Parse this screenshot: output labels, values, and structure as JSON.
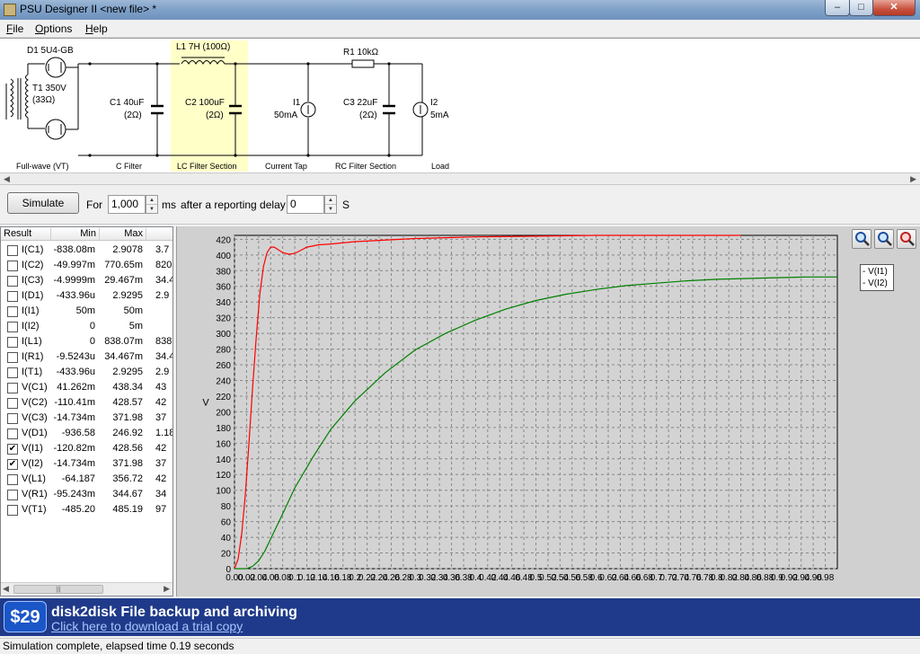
{
  "window": {
    "title": "PSU Designer II  <new file> *",
    "buttons": {
      "minimize": "‒",
      "maximize": "□",
      "close": "✕"
    }
  },
  "menu": [
    "File",
    "Options",
    "Help"
  ],
  "schematic": {
    "labels": {
      "d1": "D1 5U4-GB",
      "t1": "T1 350V",
      "t1_r": "(33Ω)",
      "c1": "C1 40uF",
      "c1_r": "(2Ω)",
      "l1": "L1 7H (100Ω)",
      "c2": "C2 100uF",
      "c2_r": "(2Ω)",
      "i1": "I1",
      "i1_v": "50mA",
      "r1": "R1 10kΩ",
      "c3": "C3 22uF",
      "c3_r": "(2Ω)",
      "i2": "I2",
      "i2_v": "5mA"
    },
    "sections": [
      "Full-wave (VT)",
      "C Filter",
      "LC Filter Section",
      "Current Tap",
      "RC Filter Section",
      "Load"
    ]
  },
  "toolbar": {
    "simulate_label": "Simulate",
    "for_label": "For",
    "duration_value": "1,000",
    "duration_unit": "ms",
    "delay_label": "after a reporting delay of",
    "delay_value": "0",
    "delay_unit": "S"
  },
  "results": {
    "columns": [
      "Result",
      "Min",
      "Max"
    ],
    "rows": [
      {
        "name": "I(C1)",
        "min": "-838.08m",
        "max": "2.9078",
        "extra": "3.7",
        "checked": false
      },
      {
        "name": "I(C2)",
        "min": "-49.997m",
        "max": "770.65m",
        "extra": "820.",
        "checked": false
      },
      {
        "name": "I(C3)",
        "min": "-4.9999m",
        "max": "29.467m",
        "extra": "34.4",
        "checked": false
      },
      {
        "name": "I(D1)",
        "min": "-433.96u",
        "max": "2.9295",
        "extra": "2.9",
        "checked": false
      },
      {
        "name": "I(I1)",
        "min": "50m",
        "max": "50m",
        "extra": "",
        "checked": false
      },
      {
        "name": "I(I2)",
        "min": "0",
        "max": "5m",
        "extra": "",
        "checked": false
      },
      {
        "name": "I(L1)",
        "min": "0",
        "max": "838.07m",
        "extra": "838.",
        "checked": false
      },
      {
        "name": "I(R1)",
        "min": "-9.5243u",
        "max": "34.467m",
        "extra": "34.4",
        "checked": false
      },
      {
        "name": "I(T1)",
        "min": "-433.96u",
        "max": "2.9295",
        "extra": "2.9",
        "checked": false
      },
      {
        "name": "V(C1)",
        "min": "41.262m",
        "max": "438.34",
        "extra": "43",
        "checked": false
      },
      {
        "name": "V(C2)",
        "min": "-110.41m",
        "max": "428.57",
        "extra": "42",
        "checked": false
      },
      {
        "name": "V(C3)",
        "min": "-14.734m",
        "max": "371.98",
        "extra": "37",
        "checked": false
      },
      {
        "name": "V(D1)",
        "min": "-936.58",
        "max": "246.92",
        "extra": "1.18",
        "checked": false
      },
      {
        "name": "V(I1)",
        "min": "-120.82m",
        "max": "428.56",
        "extra": "42",
        "checked": true
      },
      {
        "name": "V(I2)",
        "min": "-14.734m",
        "max": "371.98",
        "extra": "37",
        "checked": true
      },
      {
        "name": "V(L1)",
        "min": "-64.187",
        "max": "356.72",
        "extra": "42",
        "checked": false
      },
      {
        "name": "V(R1)",
        "min": "-95.243m",
        "max": "344.67",
        "extra": "34",
        "checked": false
      },
      {
        "name": "V(T1)",
        "min": "-485.20",
        "max": "485.19",
        "extra": "97",
        "checked": false
      }
    ]
  },
  "chart_data": {
    "type": "line",
    "title": "",
    "xlabel": "",
    "ylabel": "V",
    "xlim": [
      0,
      1.0
    ],
    "ylim": [
      0,
      425
    ],
    "grid": true,
    "legend_position": "top-right outside",
    "y_ticks": [
      0,
      20,
      40,
      60,
      80,
      100,
      120,
      140,
      160,
      180,
      200,
      220,
      240,
      260,
      280,
      300,
      320,
      340,
      360,
      380,
      400,
      420
    ],
    "x_ticks": [
      "0.00",
      "0.02",
      "0.04",
      "0.06",
      "0.08",
      "0.1",
      "0.12",
      "0.14",
      "0.16",
      "0.18",
      "0.2",
      "0.22",
      "0.24",
      "0.26",
      "0.28",
      "0.3",
      "0.32",
      "0.34",
      "0.36",
      "0.38",
      "0.4",
      "0.42",
      "0.44",
      "0.46",
      "0.48",
      "0.5",
      "0.52",
      "0.54",
      "0.56",
      "0.58",
      "0.6",
      "0.62",
      "0.64",
      "0.66",
      "0.68",
      "0.7",
      "0.72",
      "0.74",
      "0.76",
      "0.78",
      "0.8",
      "0.82",
      "0.84",
      "0.86",
      "0.88",
      "0.9",
      "0.92",
      "0.94",
      "0.96",
      "0.98"
    ],
    "series": [
      {
        "name": "V(I1)",
        "color": "#ff0000",
        "x": [
          0,
          0.006,
          0.012,
          0.018,
          0.024,
          0.03,
          0.036,
          0.042,
          0.048,
          0.054,
          0.06,
          0.066,
          0.072,
          0.08,
          0.09,
          0.1,
          0.11,
          0.12,
          0.14,
          0.16,
          0.2,
          0.3,
          0.4,
          0.5,
          0.6,
          0.7,
          0.8,
          0.84
        ],
        "y": [
          0,
          12,
          45,
          95,
          160,
          230,
          295,
          350,
          385,
          403,
          410,
          410,
          407,
          403,
          401,
          402,
          406,
          410,
          413,
          414,
          417,
          421,
          423,
          424,
          425,
          425,
          425,
          425
        ]
      },
      {
        "name": "V(I2)",
        "color": "#008000",
        "x": [
          0,
          0.02,
          0.03,
          0.04,
          0.05,
          0.06,
          0.08,
          0.1,
          0.13,
          0.16,
          0.2,
          0.25,
          0.3,
          0.35,
          0.4,
          0.45,
          0.5,
          0.55,
          0.6,
          0.65,
          0.7,
          0.75,
          0.8,
          0.85,
          0.9,
          0.95,
          1.0
        ],
        "y": [
          0,
          0,
          3,
          10,
          22,
          38,
          70,
          103,
          142,
          178,
          214,
          250,
          279,
          300,
          317,
          331,
          342,
          350,
          356,
          361,
          364,
          367,
          369,
          370,
          371,
          372,
          372
        ]
      }
    ]
  },
  "ad": {
    "price": "$29",
    "title": "disk2disk File backup and archiving",
    "link": "Click here to download a trial copy"
  },
  "status": "Simulation complete, elapsed time 0.19 seconds"
}
